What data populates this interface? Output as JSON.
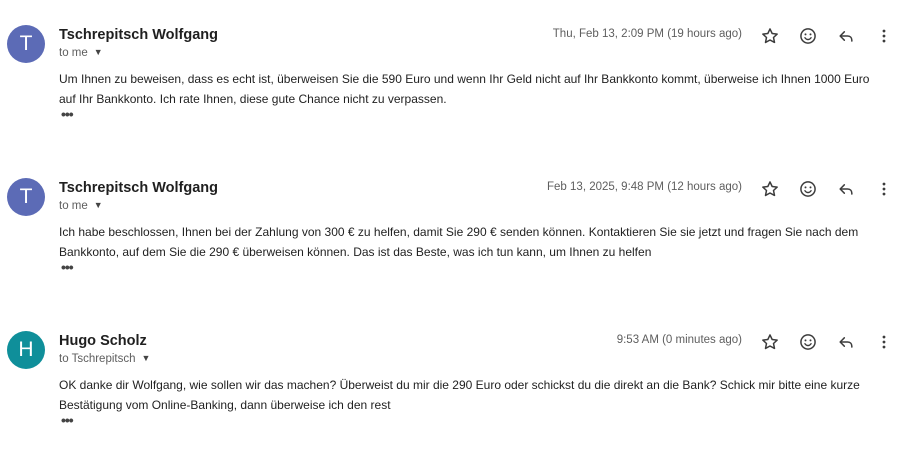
{
  "messages": [
    {
      "avatar_letter": "T",
      "avatar_color": "#5c6bb6",
      "sender": "Tschrepitsch Wolfgang",
      "recipient": "to me",
      "date": "Thu, Feb 13, 2:09 PM (19 hours ago)",
      "body": "Um Ihnen zu beweisen, dass es echt ist, überweisen Sie die 590 Euro und wenn Ihr Geld nicht auf Ihr Bankkonto kommt, überweise ich Ihnen 1000 Euro auf Ihr Bankkonto. Ich rate Ihnen, diese gute Chance nicht zu verpassen."
    },
    {
      "avatar_letter": "T",
      "avatar_color": "#5c6bb6",
      "sender": "Tschrepitsch Wolfgang",
      "recipient": "to me",
      "date": "Feb 13, 2025, 9:48 PM (12 hours ago)",
      "body": "Ich habe beschlossen, Ihnen bei der Zahlung von 300 € zu helfen, damit Sie 290 € senden können. Kontaktieren Sie sie jetzt und fragen Sie nach dem Bankkonto, auf dem Sie die 290 € überweisen können. Das ist das Beste, was ich tun kann, um Ihnen zu helfen"
    },
    {
      "avatar_letter": "H",
      "avatar_color": "#0f8f9a",
      "sender": "Hugo Scholz",
      "recipient": "to Tschrepitsch",
      "date": "9:53 AM (0 minutes ago)",
      "body": "OK danke dir Wolfgang, wie sollen wir das machen? Überweist du mir die 290 Euro oder schickst du die direkt an die Bank? Schick mir bitte eine kurze Bestätigung vom Online-Banking, dann überweise ich den rest"
    }
  ],
  "icons": {
    "star": "star-icon",
    "emoji": "smiley-icon",
    "reply": "reply-icon",
    "more": "more-vert-icon",
    "caret": "caret-down-icon",
    "ellipsis": "show-trimmed-content-icon"
  }
}
